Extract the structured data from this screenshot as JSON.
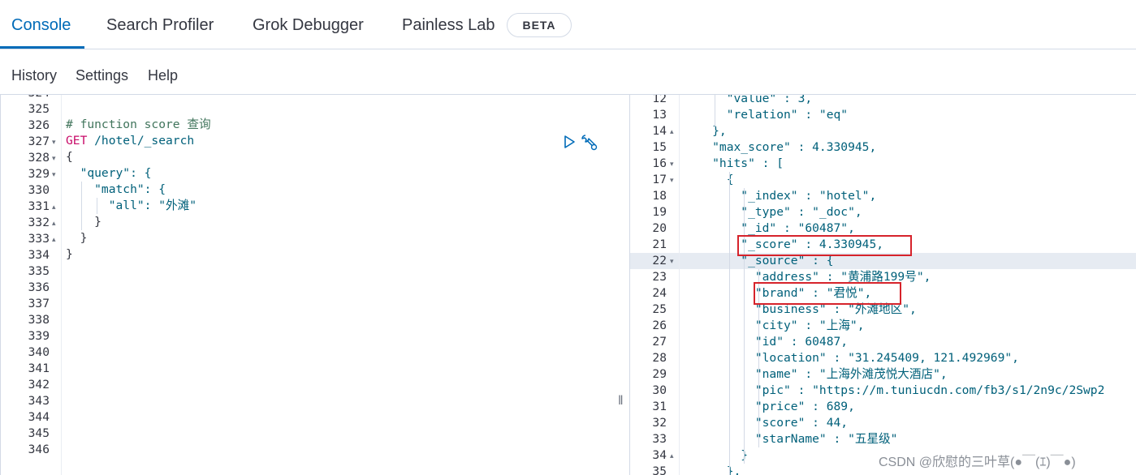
{
  "tabs": [
    {
      "label": "Console",
      "active": true
    },
    {
      "label": "Search Profiler",
      "active": false
    },
    {
      "label": "Grok Debugger",
      "active": false
    },
    {
      "label": "Painless Lab",
      "active": false
    }
  ],
  "beta_badge": "BETA",
  "menu": [
    "History",
    "Settings",
    "Help"
  ],
  "editor": {
    "line_numbers": [
      "325",
      "326",
      "327",
      "328",
      "329",
      "330",
      "331",
      "332",
      "333",
      "334",
      "335",
      "336",
      "337",
      "338",
      "339",
      "340",
      "341",
      "342",
      "343",
      "344",
      "345",
      "346"
    ],
    "first_partial_number": "324",
    "comment": "# function score 查询",
    "method": "GET",
    "url": " /hotel/_search",
    "lines": [
      "{",
      "  \"query\": {",
      "    \"match\": {",
      "      \"all\": \"外滩\"",
      "    }",
      "  }",
      "}"
    ]
  },
  "response": {
    "line_numbers": [
      "12",
      "13",
      "14",
      "15",
      "16",
      "17",
      "18",
      "19",
      "20",
      "21",
      "22",
      "23",
      "24",
      "25",
      "26",
      "27",
      "28",
      "29",
      "30",
      "31",
      "32",
      "33",
      "34",
      "35"
    ],
    "lines": [
      "      \"value\" : 3,",
      "      \"relation\" : \"eq\"",
      "    },",
      "    \"max_score\" : 4.330945,",
      "    \"hits\" : [",
      "      {",
      "        \"_index\" : \"hotel\",",
      "        \"_type\" : \"_doc\",",
      "        \"_id\" : \"60487\",",
      "        \"_score\" : 4.330945,",
      "        \"_source\" : {",
      "          \"address\" : \"黄浦路199号\",",
      "          \"brand\" : \"君悦\",",
      "          \"business\" : \"外滩地区\",",
      "          \"city\" : \"上海\",",
      "          \"id\" : 60487,",
      "          \"location\" : \"31.245409, 121.492969\",",
      "          \"name\" : \"上海外滩茂悦大酒店\",",
      "          \"pic\" : \"https://m.tuniucdn.com/fb3/s1/2n9c/2Swp2",
      "          \"price\" : 689,",
      "          \"score\" : 44,",
      "          \"starName\" : \"五星级\"",
      "        }",
      "      },"
    ]
  },
  "watermark": "CSDN @欣慰的三叶草(●￣(ｴ)￣●)",
  "splitter_glyph": "‖",
  "icons": [
    "play-icon",
    "wrench-icon",
    "fold-arrow-icon"
  ],
  "colors": {
    "accent": "#006bb8",
    "method": "#c80a68",
    "comment": "#41755c",
    "value": "#00607a",
    "highlight_box": "#d6232b"
  }
}
